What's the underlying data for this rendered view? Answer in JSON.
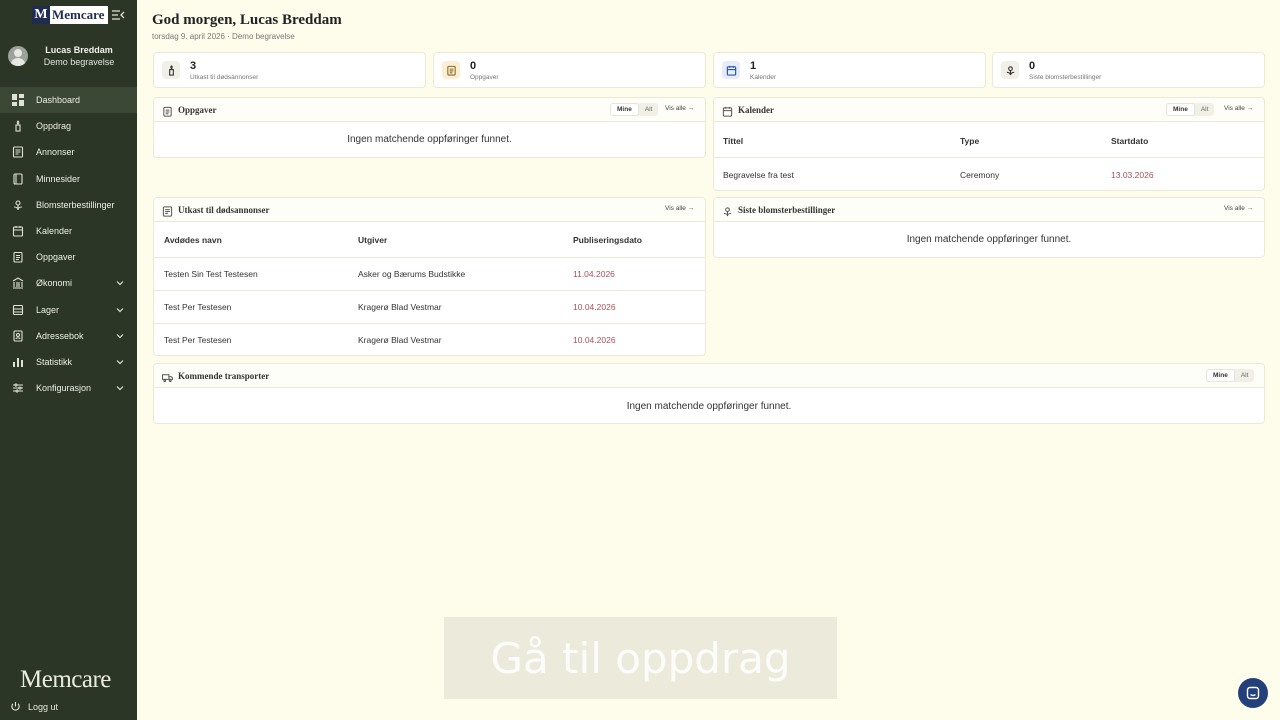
{
  "brand": {
    "logo_letter": "M",
    "logo_word": "Memcare",
    "footer_logo": "Memcare"
  },
  "profile": {
    "name": "Lucas Breddam",
    "org": "Demo begravelse"
  },
  "nav": [
    {
      "label": "Dashboard",
      "icon": "dashboard-icon",
      "active": true
    },
    {
      "label": "Oppdrag",
      "icon": "candle-icon"
    },
    {
      "label": "Annonser",
      "icon": "newspaper-icon"
    },
    {
      "label": "Minnesider",
      "icon": "book-icon"
    },
    {
      "label": "Blomsterbestillinger",
      "icon": "flower-icon"
    },
    {
      "label": "Kalender",
      "icon": "calendar-icon"
    },
    {
      "label": "Oppgaver",
      "icon": "clipboard-icon"
    },
    {
      "label": "Økonomi",
      "icon": "bank-icon",
      "chevron": true
    },
    {
      "label": "Lager",
      "icon": "box-icon",
      "chevron": true
    },
    {
      "label": "Adressebok",
      "icon": "address-book-icon",
      "chevron": true
    },
    {
      "label": "Statistikk",
      "icon": "bar-chart-icon",
      "chevron": true
    },
    {
      "label": "Konfigurasjon",
      "icon": "sliders-icon",
      "chevron": true
    }
  ],
  "logout_label": "Logg ut",
  "header": {
    "greeting": "God morgen, Lucas Breddam",
    "subline": "torsdag 9. april 2026 · Demo begravelse"
  },
  "stats": [
    {
      "value": "3",
      "label": "Utkast til dødsannonser",
      "icon": "candle-icon",
      "bg": "#f1f0e6"
    },
    {
      "value": "0",
      "label": "Oppgaver",
      "icon": "clipboard-icon",
      "bg": "#fbeed2"
    },
    {
      "value": "1",
      "label": "Kalender",
      "icon": "calendar-icon",
      "bg": "#e6ecf8"
    },
    {
      "value": "0",
      "label": "Siste blomsterbestillinger",
      "icon": "flower-icon",
      "bg": "#f1f0e6"
    }
  ],
  "seg": {
    "mine": "Mine",
    "alt": "Alt"
  },
  "vis_alle": "Vis alle →",
  "empty": "Ingen matchende oppføringer funnet.",
  "panels": {
    "oppgaver": {
      "title": "Oppgaver"
    },
    "kalender": {
      "title": "Kalender",
      "columns": [
        "Tittel",
        "Type",
        "Startdato"
      ],
      "rows": [
        [
          "Begravelse fra test",
          "Ceremony",
          "13.03.2026"
        ]
      ]
    },
    "utkast": {
      "title": "Utkast til dødsannonser",
      "columns": [
        "Avdødes navn",
        "Utgiver",
        "Publiseringsdato"
      ],
      "rows": [
        [
          "Testen Sin Test Testesen",
          "Asker og Bærums Budstikke",
          "11.04.2026"
        ],
        [
          "Test Per Testesen",
          "Kragerø Blad Vestmar",
          "10.04.2026"
        ],
        [
          "Test Per Testesen",
          "Kragerø Blad Vestmar",
          "10.04.2026"
        ]
      ]
    },
    "blomster": {
      "title": "Siste blomsterbestillinger"
    },
    "transporter": {
      "title": "Kommende transporter"
    }
  },
  "overlay": "Gå til oppdrag",
  "colors": {
    "sidebar": "#2b3626",
    "page": "#fefdeb",
    "date": "#a8505a",
    "chat": "#24407a"
  }
}
